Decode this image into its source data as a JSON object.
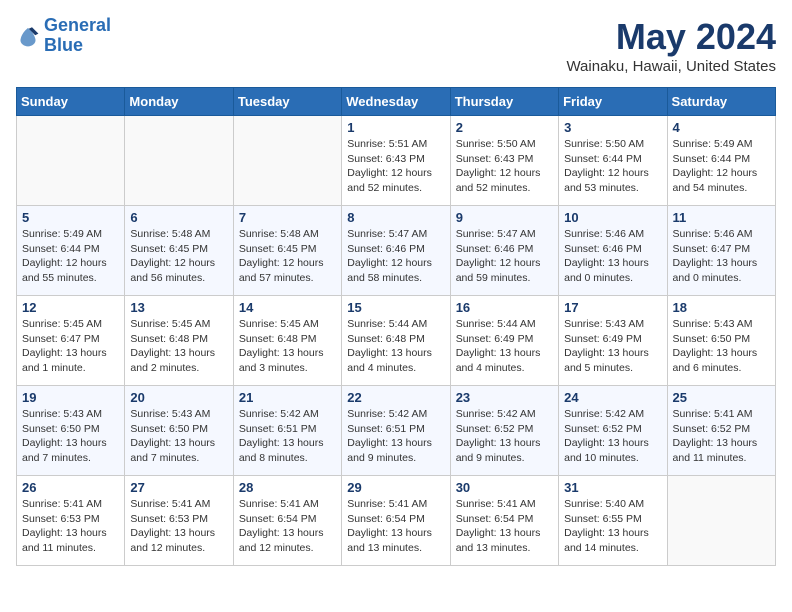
{
  "header": {
    "logo_line1": "General",
    "logo_line2": "Blue",
    "title": "May 2024",
    "subtitle": "Wainaku, Hawaii, United States"
  },
  "days_of_week": [
    "Sunday",
    "Monday",
    "Tuesday",
    "Wednesday",
    "Thursday",
    "Friday",
    "Saturday"
  ],
  "weeks": [
    [
      {
        "day": "",
        "content": ""
      },
      {
        "day": "",
        "content": ""
      },
      {
        "day": "",
        "content": ""
      },
      {
        "day": "1",
        "content": "Sunrise: 5:51 AM\nSunset: 6:43 PM\nDaylight: 12 hours\nand 52 minutes."
      },
      {
        "day": "2",
        "content": "Sunrise: 5:50 AM\nSunset: 6:43 PM\nDaylight: 12 hours\nand 52 minutes."
      },
      {
        "day": "3",
        "content": "Sunrise: 5:50 AM\nSunset: 6:44 PM\nDaylight: 12 hours\nand 53 minutes."
      },
      {
        "day": "4",
        "content": "Sunrise: 5:49 AM\nSunset: 6:44 PM\nDaylight: 12 hours\nand 54 minutes."
      }
    ],
    [
      {
        "day": "5",
        "content": "Sunrise: 5:49 AM\nSunset: 6:44 PM\nDaylight: 12 hours\nand 55 minutes."
      },
      {
        "day": "6",
        "content": "Sunrise: 5:48 AM\nSunset: 6:45 PM\nDaylight: 12 hours\nand 56 minutes."
      },
      {
        "day": "7",
        "content": "Sunrise: 5:48 AM\nSunset: 6:45 PM\nDaylight: 12 hours\nand 57 minutes."
      },
      {
        "day": "8",
        "content": "Sunrise: 5:47 AM\nSunset: 6:46 PM\nDaylight: 12 hours\nand 58 minutes."
      },
      {
        "day": "9",
        "content": "Sunrise: 5:47 AM\nSunset: 6:46 PM\nDaylight: 12 hours\nand 59 minutes."
      },
      {
        "day": "10",
        "content": "Sunrise: 5:46 AM\nSunset: 6:46 PM\nDaylight: 13 hours\nand 0 minutes."
      },
      {
        "day": "11",
        "content": "Sunrise: 5:46 AM\nSunset: 6:47 PM\nDaylight: 13 hours\nand 0 minutes."
      }
    ],
    [
      {
        "day": "12",
        "content": "Sunrise: 5:45 AM\nSunset: 6:47 PM\nDaylight: 13 hours\nand 1 minute."
      },
      {
        "day": "13",
        "content": "Sunrise: 5:45 AM\nSunset: 6:48 PM\nDaylight: 13 hours\nand 2 minutes."
      },
      {
        "day": "14",
        "content": "Sunrise: 5:45 AM\nSunset: 6:48 PM\nDaylight: 13 hours\nand 3 minutes."
      },
      {
        "day": "15",
        "content": "Sunrise: 5:44 AM\nSunset: 6:48 PM\nDaylight: 13 hours\nand 4 minutes."
      },
      {
        "day": "16",
        "content": "Sunrise: 5:44 AM\nSunset: 6:49 PM\nDaylight: 13 hours\nand 4 minutes."
      },
      {
        "day": "17",
        "content": "Sunrise: 5:43 AM\nSunset: 6:49 PM\nDaylight: 13 hours\nand 5 minutes."
      },
      {
        "day": "18",
        "content": "Sunrise: 5:43 AM\nSunset: 6:50 PM\nDaylight: 13 hours\nand 6 minutes."
      }
    ],
    [
      {
        "day": "19",
        "content": "Sunrise: 5:43 AM\nSunset: 6:50 PM\nDaylight: 13 hours\nand 7 minutes."
      },
      {
        "day": "20",
        "content": "Sunrise: 5:43 AM\nSunset: 6:50 PM\nDaylight: 13 hours\nand 7 minutes."
      },
      {
        "day": "21",
        "content": "Sunrise: 5:42 AM\nSunset: 6:51 PM\nDaylight: 13 hours\nand 8 minutes."
      },
      {
        "day": "22",
        "content": "Sunrise: 5:42 AM\nSunset: 6:51 PM\nDaylight: 13 hours\nand 9 minutes."
      },
      {
        "day": "23",
        "content": "Sunrise: 5:42 AM\nSunset: 6:52 PM\nDaylight: 13 hours\nand 9 minutes."
      },
      {
        "day": "24",
        "content": "Sunrise: 5:42 AM\nSunset: 6:52 PM\nDaylight: 13 hours\nand 10 minutes."
      },
      {
        "day": "25",
        "content": "Sunrise: 5:41 AM\nSunset: 6:52 PM\nDaylight: 13 hours\nand 11 minutes."
      }
    ],
    [
      {
        "day": "26",
        "content": "Sunrise: 5:41 AM\nSunset: 6:53 PM\nDaylight: 13 hours\nand 11 minutes."
      },
      {
        "day": "27",
        "content": "Sunrise: 5:41 AM\nSunset: 6:53 PM\nDaylight: 13 hours\nand 12 minutes."
      },
      {
        "day": "28",
        "content": "Sunrise: 5:41 AM\nSunset: 6:54 PM\nDaylight: 13 hours\nand 12 minutes."
      },
      {
        "day": "29",
        "content": "Sunrise: 5:41 AM\nSunset: 6:54 PM\nDaylight: 13 hours\nand 13 minutes."
      },
      {
        "day": "30",
        "content": "Sunrise: 5:41 AM\nSunset: 6:54 PM\nDaylight: 13 hours\nand 13 minutes."
      },
      {
        "day": "31",
        "content": "Sunrise: 5:40 AM\nSunset: 6:55 PM\nDaylight: 13 hours\nand 14 minutes."
      },
      {
        "day": "",
        "content": ""
      }
    ]
  ]
}
